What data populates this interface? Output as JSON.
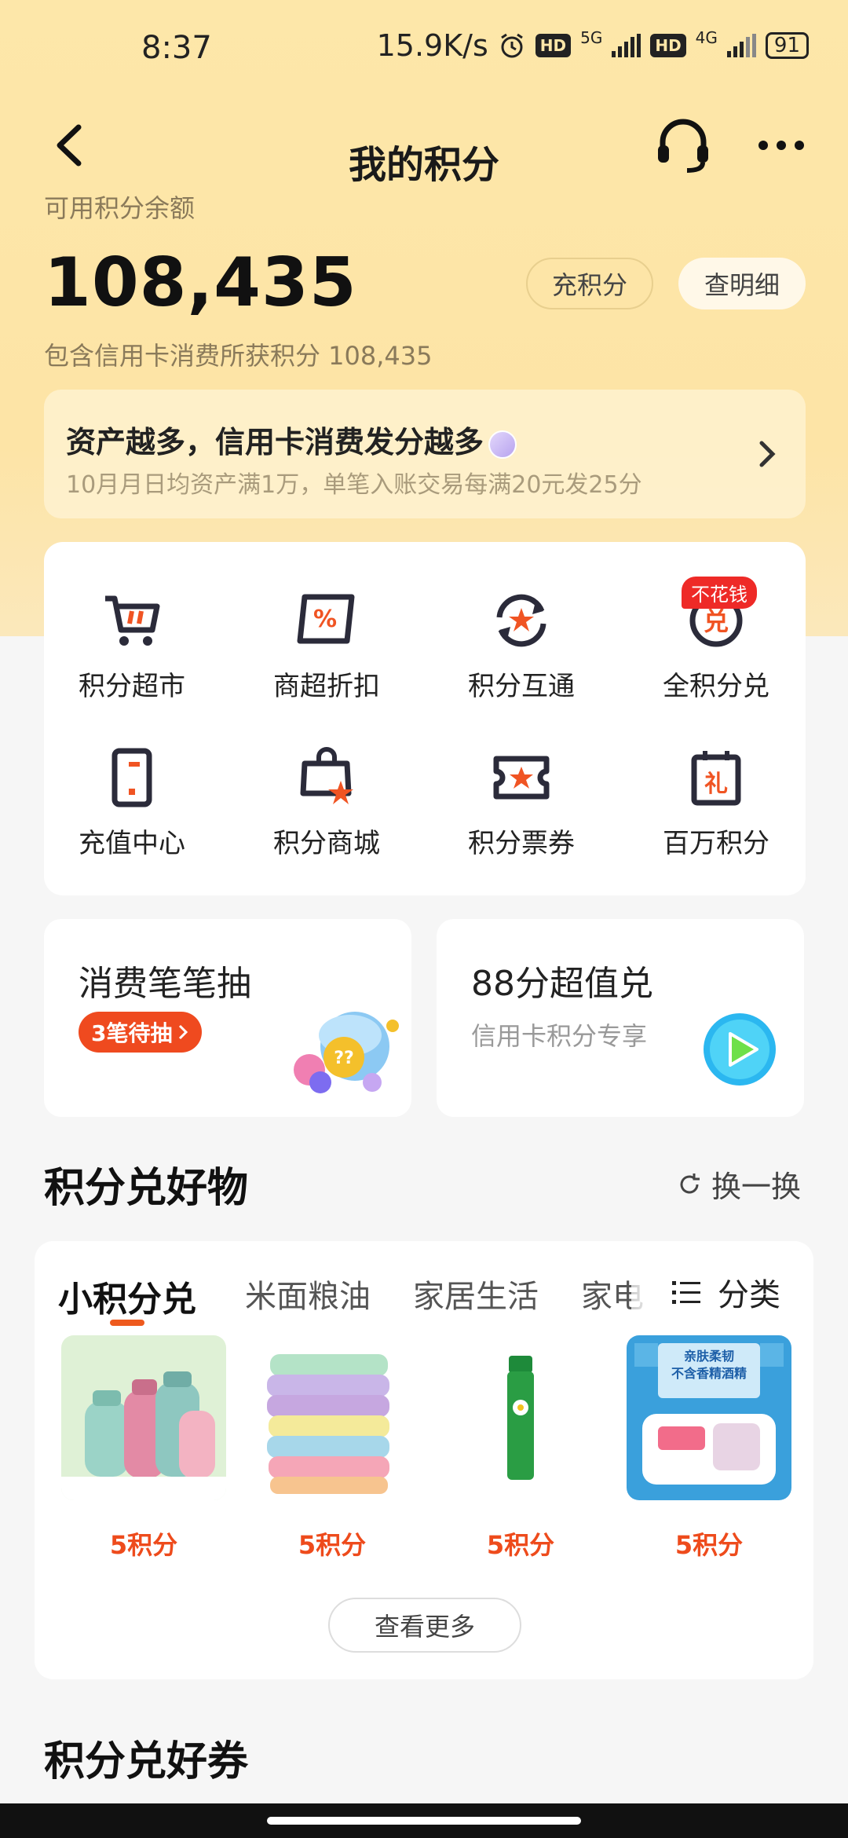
{
  "status_bar": {
    "time": "8:37",
    "network_speed": "15.9K/s",
    "hd1": "HD",
    "net1": "5G",
    "hd2": "HD",
    "net2": "4G",
    "battery": "91"
  },
  "nav": {
    "title": "我的积分"
  },
  "balance": {
    "label": "可用积分余额",
    "value": "108,435",
    "recharge_label": "充积分",
    "detail_label": "查明细",
    "note": "包含信用卡消费所获积分 108,435"
  },
  "promo": {
    "title": "资产越多，信用卡消费发分越多",
    "subtitle": "10月月日均资产满1万，单笔入账交易每满20元发25分"
  },
  "menu": {
    "items": [
      {
        "label": "积分超市",
        "icon": "cart-icon"
      },
      {
        "label": "商超折扣",
        "icon": "discount-icon"
      },
      {
        "label": "积分互通",
        "icon": "exchange-icon"
      },
      {
        "label": "全积分兑",
        "icon": "redeem-icon"
      },
      {
        "label": "充值中心",
        "icon": "phone-icon"
      },
      {
        "label": "积分商城",
        "icon": "bag-icon"
      },
      {
        "label": "积分票券",
        "icon": "ticket-icon"
      },
      {
        "label": "百万积分",
        "icon": "gift-calendar-icon"
      }
    ],
    "badge": "不花钱"
  },
  "cards": {
    "lottery_title": "消费笔笔抽",
    "lottery_pill": "3笔待抽",
    "exchange_title": "88分超值兑",
    "exchange_sub": "信用卡积分专享"
  },
  "goods_section": {
    "title": "积分兑好物",
    "refresh": "换一换",
    "tabs": [
      "小积分兑",
      "米面粮油",
      "家居生活",
      "家电"
    ],
    "category": "分类",
    "items": [
      {
        "price": "5积分",
        "image": "thermos-cups"
      },
      {
        "price": "5积分",
        "image": "towel-stack"
      },
      {
        "price": "5积分",
        "image": "lip-balm"
      },
      {
        "price": "5积分",
        "image": "wet-wipes"
      }
    ],
    "wipes_text_1": "亲肤柔韧",
    "wipes_text_2": "不含香精酒精",
    "more": "查看更多"
  },
  "coupon_section": {
    "title": "积分兑好券"
  },
  "colors": {
    "accent": "#ee4b1c",
    "header_bg": "#fde7a9",
    "badge_red": "#ee2a27",
    "icon_dark": "#2b2b3a",
    "icon_orange": "#f05423"
  }
}
